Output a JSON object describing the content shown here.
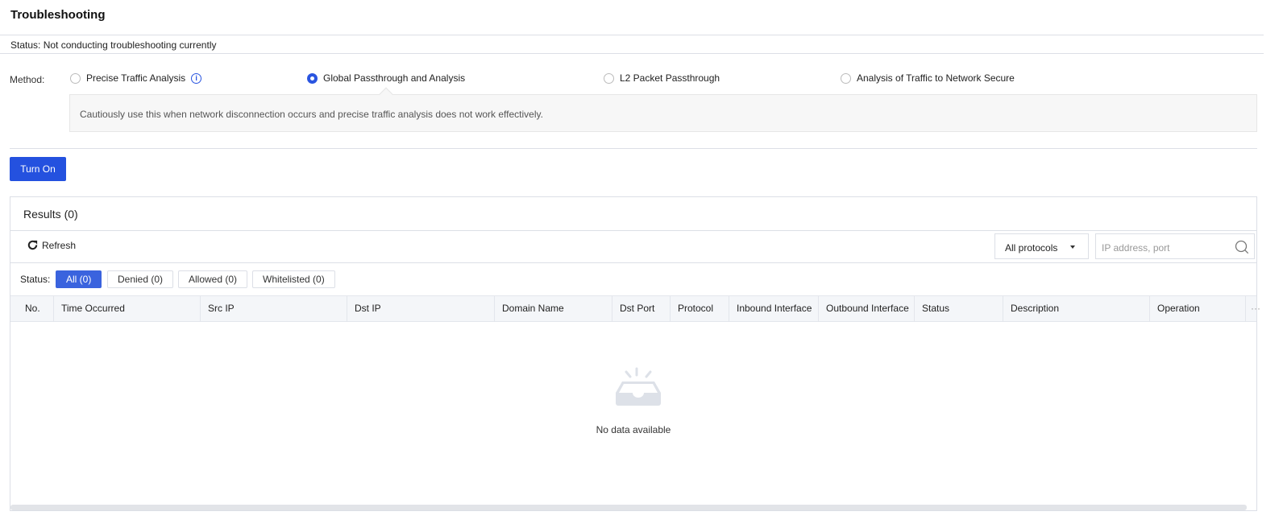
{
  "title": "Troubleshooting",
  "status_text": "Status: Not conducting troubleshooting currently",
  "method": {
    "label": "Method:",
    "options": [
      {
        "label": "Precise Traffic Analysis",
        "selected": false
      },
      {
        "label": "Global Passthrough and Analysis",
        "selected": true
      },
      {
        "label": "L2 Packet Passthrough",
        "selected": false
      },
      {
        "label": "Analysis of Traffic to Network Secure",
        "selected": false
      }
    ],
    "tip": "Cautiously use this when network disconnection occurs and precise traffic analysis does not work effectively."
  },
  "turn_on": "Turn On",
  "results": {
    "title": "Results (0)",
    "refresh": "Refresh",
    "protocol": "All protocols",
    "search_placeholder": "IP address, port",
    "status_label": "Status:",
    "filters": [
      "All (0)",
      "Denied (0)",
      "Allowed (0)",
      "Whitelisted (0)"
    ],
    "columns": [
      "No.",
      "Time Occurred",
      "Src IP",
      "Dst IP",
      "Domain Name",
      "Dst Port",
      "Protocol",
      "Inbound Interface",
      "Outbound Interface",
      "Status",
      "Description",
      "Operation",
      "···"
    ],
    "empty": "No data available"
  },
  "colors": {
    "accent": "#2451df"
  }
}
